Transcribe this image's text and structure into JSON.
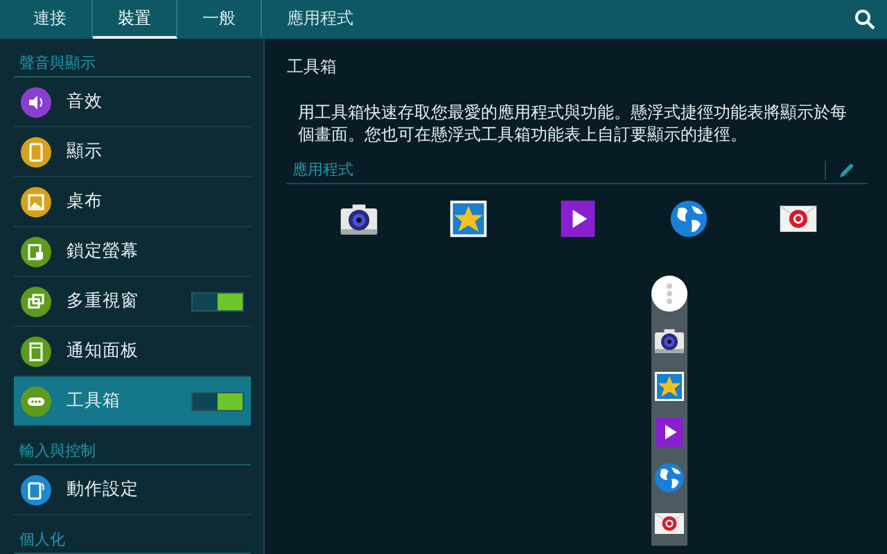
{
  "tabs": [
    {
      "label": "連接",
      "selected": false
    },
    {
      "label": "裝置",
      "selected": true
    },
    {
      "label": "一般",
      "selected": false
    },
    {
      "label": "應用程式",
      "selected": false
    }
  ],
  "sidebar": {
    "sections": [
      {
        "title": "聲音與顯示",
        "items": [
          {
            "label": "音效",
            "kind": "plain",
            "selected": false,
            "color": "#8b3fd1"
          },
          {
            "label": "顯示",
            "kind": "plain",
            "selected": false,
            "color": "#d6a21a"
          },
          {
            "label": "桌布",
            "kind": "plain",
            "selected": false,
            "color": "#d6a21a"
          },
          {
            "label": "鎖定螢幕",
            "kind": "plain",
            "selected": false,
            "color": "#5e9a1c"
          },
          {
            "label": "多重視窗",
            "kind": "switch",
            "on": true,
            "selected": false,
            "color": "#5e9a1c"
          },
          {
            "label": "通知面板",
            "kind": "plain",
            "selected": false,
            "color": "#5e9a1c"
          },
          {
            "label": "工具箱",
            "kind": "switch",
            "on": true,
            "selected": true,
            "color": "#5e9a1c"
          }
        ]
      },
      {
        "title": "輸入與控制",
        "items": [
          {
            "label": "動作設定",
            "kind": "plain",
            "selected": false,
            "color": "#1b88d0"
          }
        ]
      },
      {
        "title": "個人化"
      }
    ]
  },
  "detail": {
    "title": "工具箱",
    "description": "用工具箱快速存取您最愛的應用程式與功能。懸浮式捷徑功能表將顯示於每個畫面。您也可在懸浮式工具箱功能表上自訂要顯示的捷徑。",
    "apps_heading": "應用程式"
  }
}
